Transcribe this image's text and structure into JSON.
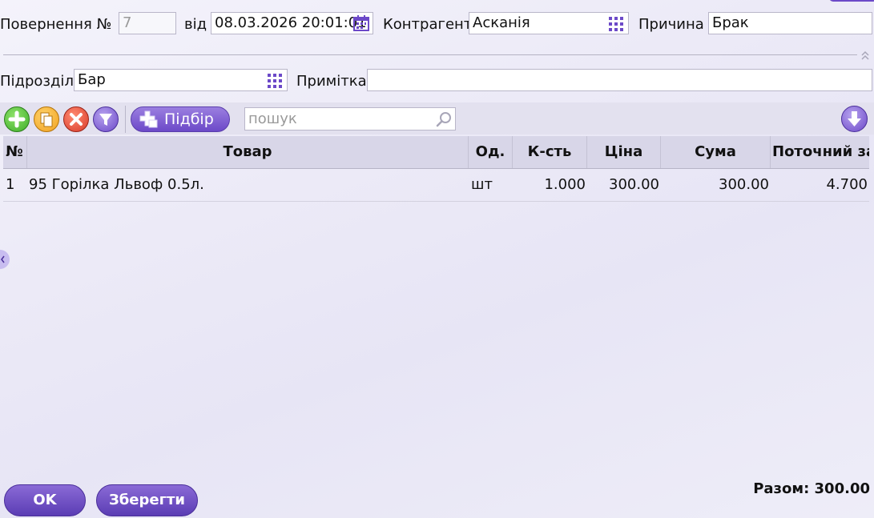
{
  "header": {
    "return_label": "Повернення №",
    "return_number": "7",
    "date_label": "від",
    "date_value": "08.03.2026 20:01:01",
    "counterparty_label": "Контрагент",
    "counterparty_value": "Асканія",
    "reason_label": "Причина",
    "reason_value": "Брак",
    "department_label": "Підрозділ",
    "department_value": "Бар",
    "note_label": "Примітка",
    "note_value": ""
  },
  "toolbar": {
    "pick_label": "Підбір",
    "search_placeholder": "пошук"
  },
  "table": {
    "columns": [
      "№",
      "Товар",
      "Од.",
      "К-сть",
      "Ціна",
      "Сума",
      "Поточний за"
    ],
    "rows": [
      {
        "num": "1",
        "product": "95 Горілка Львоф 0.5л.",
        "unit": "шт",
        "qty": "1.000",
        "price": "300.00",
        "sum": "300.00",
        "current": "4.700"
      }
    ]
  },
  "footer": {
    "ok_label": "OK",
    "save_label": "Зберегти",
    "total_text": "Разом: 300.00"
  },
  "colors": {
    "accent": "#6c49c8",
    "add_green": "#3fae2a",
    "copy_orange": "#f0a020",
    "delete_red": "#d83a2a"
  }
}
